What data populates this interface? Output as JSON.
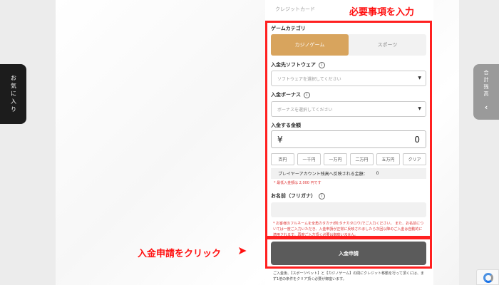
{
  "side": {
    "left_tab": "お気に入り",
    "right_tab": "合計残高",
    "right_chevron": "chevron-left-icon"
  },
  "form": {
    "credit_label": "クレジットカード",
    "game_category_label": "ゲームカテゴリ",
    "categories": [
      {
        "label": "カジノゲーム",
        "active": true
      },
      {
        "label": "スポーツ",
        "active": false
      }
    ],
    "software_label": "入金先ソフトウェア",
    "software_placeholder": "ソフトウェアを選択してください",
    "bonus_label": "入金ボーナス",
    "bonus_placeholder": "ボーナスを選択してください",
    "amount_label": "入金する金額",
    "currency": "¥",
    "amount_value": "0",
    "quick_amounts": [
      "百円",
      "一千円",
      "一万円",
      "二万円",
      "五万円",
      "クリア"
    ],
    "reflect_label": "プレイヤーアカウント残高へ反映される金額：",
    "reflect_value": "0",
    "min_note": "* 最低入金額は 2,000 円です",
    "name_label": "お名前（フリガナ）",
    "notice": "* お客様のフルネームを全角カタカナ(例:タナカタロウ)でご入力ください。 また、お名前については一度ご入力いただき、入金申請が正常に反映されましたら次回以降のご入金は自動的に適用されます。再度ご入力頂く必要は御座いません。",
    "submit_label": "入金申請",
    "footer": "ご入金後、【スポーツベット】と【カジノゲーム】の間にクレジット移動を行って頂くには、まず1倍の条件をクリア頂く必要が御座います。"
  },
  "annotations": {
    "top": "必要事項を入力",
    "bottom": "入金申請をクリック"
  },
  "colors": {
    "accent": "#d8a45d",
    "annotation": "#ff1010",
    "submit_bg": "#5b5b5b"
  }
}
